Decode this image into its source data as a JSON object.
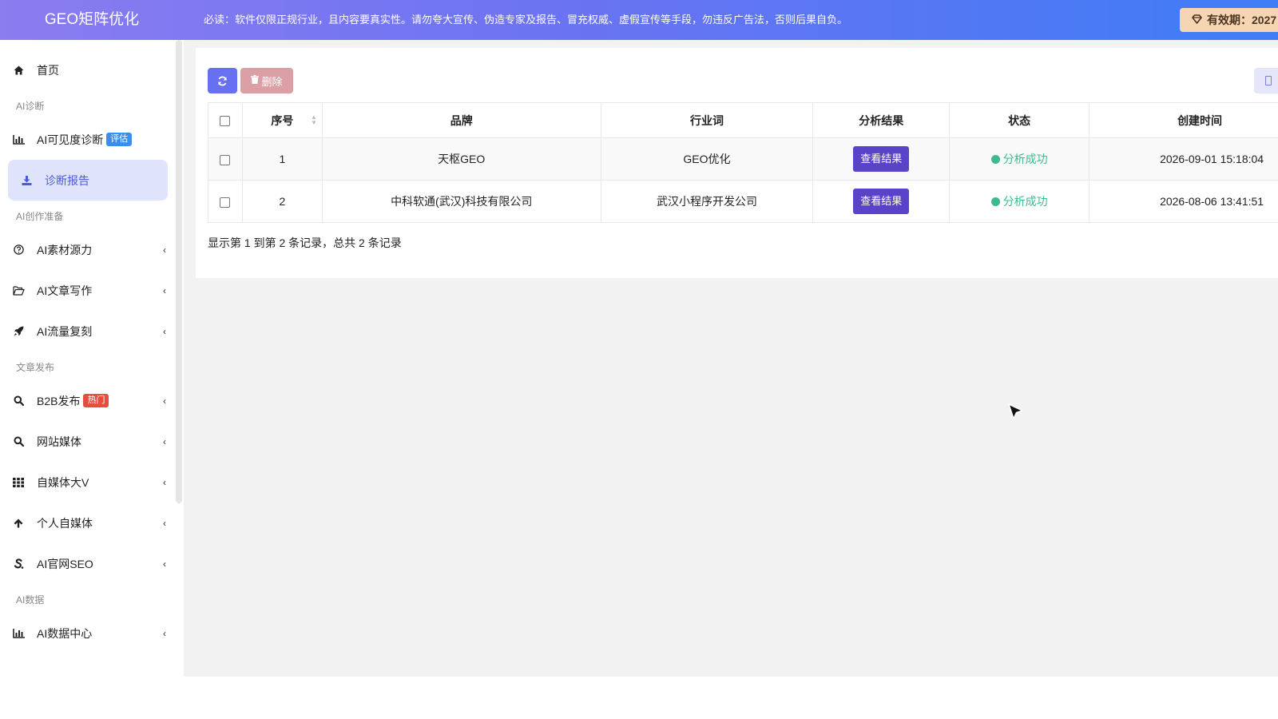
{
  "header": {
    "brand": "GEO矩阵优化",
    "notice": "必读：软件仅限正规行业，且内容要真实性。请勿夸大宣传、伪造专家及报告、冒充权威、虚假宣传等手段，勿违反广告法，否则后果自负。",
    "expiry": "有效期：2027"
  },
  "sidebar": {
    "home": "首页",
    "sections": {
      "diagnose": "AI诊断",
      "prepare": "AI创作准备",
      "publish": "文章发布",
      "data": "AI数据"
    },
    "items": {
      "visibility": "AI可见度诊断",
      "visibility_badge": "评估",
      "report": "诊断报告",
      "material": "AI素材源力",
      "writing": "AI文章写作",
      "traffic": "AI流量复刻",
      "b2b": "B2B发布",
      "b2b_badge": "热门",
      "website": "网站媒体",
      "bigv": "自媒体大V",
      "personal": "个人自媒体",
      "seo": "AI官网SEO",
      "datacenter": "AI数据中心"
    }
  },
  "toolbar": {
    "delete_label": "删除"
  },
  "table": {
    "headers": {
      "index": "序号",
      "brand": "品牌",
      "keyword": "行业词",
      "result": "分析结果",
      "status": "状态",
      "created": "创建时间"
    },
    "rows": [
      {
        "index": "1",
        "brand": "天枢GEO",
        "keyword": "GEO优化",
        "result": "查看结果",
        "status": "分析成功",
        "created": "2026-09-01 15:18:04"
      },
      {
        "index": "2",
        "brand": "中科软通(武汉)科技有限公司",
        "keyword": "武汉小程序开发公司",
        "result": "查看结果",
        "status": "分析成功",
        "created": "2026-08-06 13:41:51"
      }
    ],
    "summary": "显示第 1 到第 2 条记录，总共 2 条记录"
  },
  "colors": {
    "accent": "#5b43c9",
    "success": "#3dbb8f",
    "active_bg": "#dfe3fb"
  }
}
